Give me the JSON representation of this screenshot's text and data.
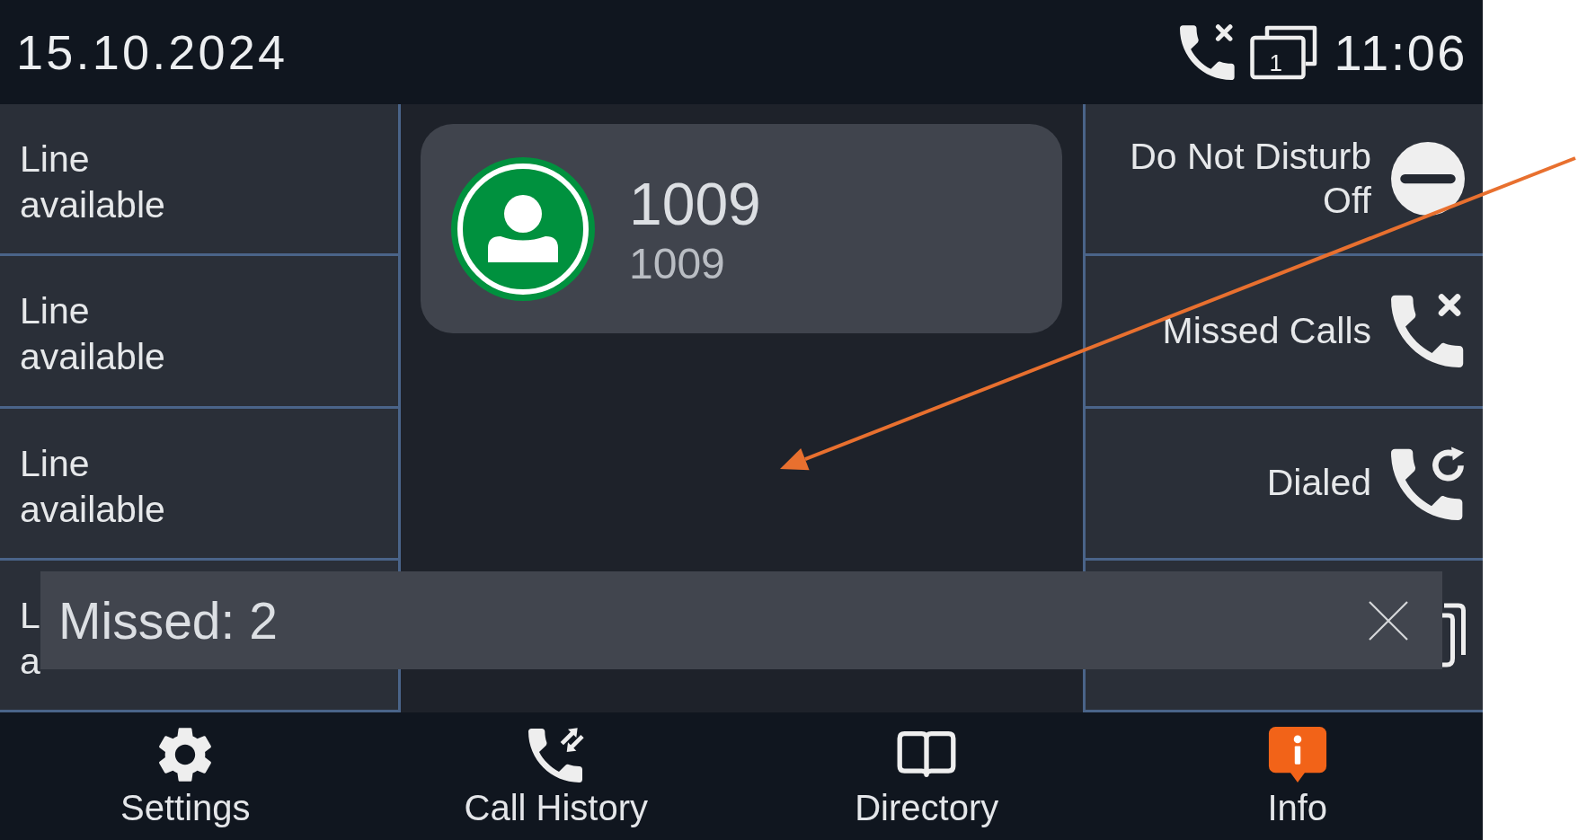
{
  "status_bar": {
    "date": "15.10.2024",
    "window_count": "1",
    "time": "11:06"
  },
  "line_keys": [
    {
      "line1": "Line",
      "line2": "available"
    },
    {
      "line1": "Line",
      "line2": "available"
    },
    {
      "line1": "Line",
      "line2": "available"
    },
    {
      "line1": "L",
      "line2": "a"
    }
  ],
  "contact_card": {
    "name": "1009",
    "number": "1009"
  },
  "quick_keys": [
    {
      "kind": "status",
      "label": "Do Not Disturb",
      "status": "Off"
    },
    {
      "kind": "key",
      "label": "Missed Calls"
    },
    {
      "kind": "key",
      "label": "Dialed"
    },
    {
      "kind": "covered"
    }
  ],
  "notification": {
    "text": "Missed: 2"
  },
  "softkeys": [
    {
      "label": "Settings",
      "alert": false
    },
    {
      "label": "Call History",
      "alert": false
    },
    {
      "label": "Directory",
      "alert": false
    },
    {
      "label": "Info",
      "alert": true
    }
  ]
}
